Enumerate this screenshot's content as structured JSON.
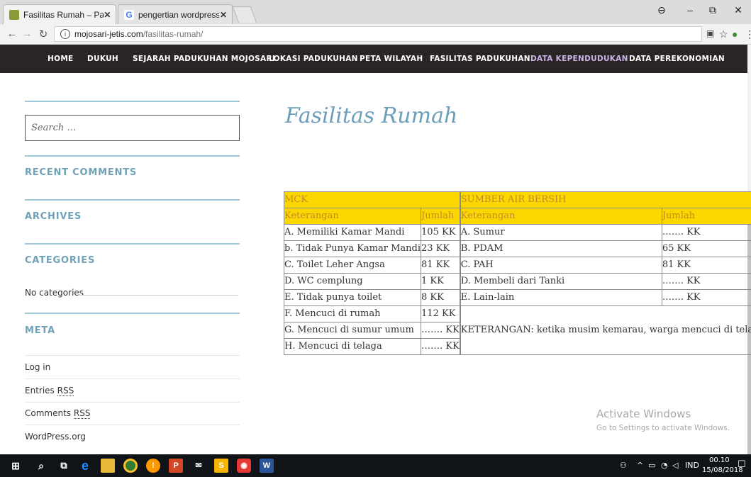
{
  "browser": {
    "tabs": [
      {
        "label": "Fasilitas Rumah – Paduku",
        "favicon_color": "#8a9b38",
        "active": true
      },
      {
        "label": "pengertian wordpress - P",
        "favicon_color": "#4285f4",
        "active": false
      }
    ],
    "tab_close_glyph": "✕",
    "url_host": "mojosari-jetis.com",
    "url_path": "/fasilitas-rumah/",
    "window_controls": {
      "account": "⊖",
      "minimize": "–",
      "maximize": "⧉",
      "close": "✕"
    }
  },
  "site_nav": {
    "items": [
      {
        "label": "HOME",
        "accent": false
      },
      {
        "label": "DUKUH",
        "accent": false
      },
      {
        "label": "SEJARAH PADUKUHAN MOJOSARI",
        "accent": false
      },
      {
        "label": "LOKASI PADUKUHAN",
        "accent": false
      },
      {
        "label": "PETA WILAYAH",
        "accent": false
      },
      {
        "label": "FASILITAS PADUKUHAN",
        "accent": false
      },
      {
        "label": "DATA KEPENDUDUKAN",
        "accent": true
      },
      {
        "label": "DATA PEREKONOMIAN",
        "accent": false
      }
    ]
  },
  "sidebar": {
    "search_placeholder": "Search …",
    "recent_comments": "RECENT COMMENTS",
    "archives": "ARCHIVES",
    "categories": "CATEGORIES",
    "no_categories": "No categories",
    "meta": "META",
    "meta_links": {
      "login": "Log in",
      "entries_prefix": "Entries ",
      "entries_abbr": "RSS",
      "comments_prefix": "Comments ",
      "comments_abbr": "RSS",
      "wordpress": "WordPress.org"
    }
  },
  "main": {
    "page_title": "Fasilitas Rumah",
    "table": {
      "mck_title": "MCK",
      "air_title": "SUMBER AIR BERSIH",
      "col_keterangan": "Keterangan",
      "col_jumlah": "Jumlah",
      "mck_rows": [
        {
          "ket": "A. Memiliki Kamar Mandi",
          "jml": "105 KK"
        },
        {
          "ket": "b. Tidak Punya Kamar Mandi",
          "jml": "23 KK"
        },
        {
          "ket": "C. Toilet Leher Angsa",
          "jml": "81 KK"
        },
        {
          "ket": "D. WC cemplung",
          "jml": "1 KK"
        },
        {
          "ket": "E. Tidak punya toilet",
          "jml": "8 KK"
        },
        {
          "ket": "F. Mencuci di rumah",
          "jml": "112 KK"
        },
        {
          "ket": "G. Mencuci di sumur umum",
          "jml": "……. KK"
        },
        {
          "ket": "H. Mencuci di telaga",
          "jml": "……. KK"
        }
      ],
      "air_rows": [
        {
          "ket": "A. Sumur",
          "jml": "……. KK"
        },
        {
          "ket": "B. PDAM",
          "jml": "65 KK"
        },
        {
          "ket": "C. PAH",
          "jml": "81 KK"
        },
        {
          "ket": "D. Membeli dari Tanki",
          "jml": "……. KK"
        },
        {
          "ket": "E. Lain-lain",
          "jml": "……. KK"
        }
      ],
      "note": "KETERANGAN: ketika musim kemarau, warga mencuci di telaga"
    }
  },
  "watermark": {
    "line1": "Activate Windows",
    "line2": "Go to Settings to activate Windows."
  },
  "taskbar": {
    "tray_lang": "IND",
    "clock_time": "00.10",
    "clock_date": "15/08/2018"
  },
  "colors": {
    "nav_bg": "#2a2424",
    "accent_blue": "#6b9fbb",
    "table_yellow": "#ffd700"
  }
}
